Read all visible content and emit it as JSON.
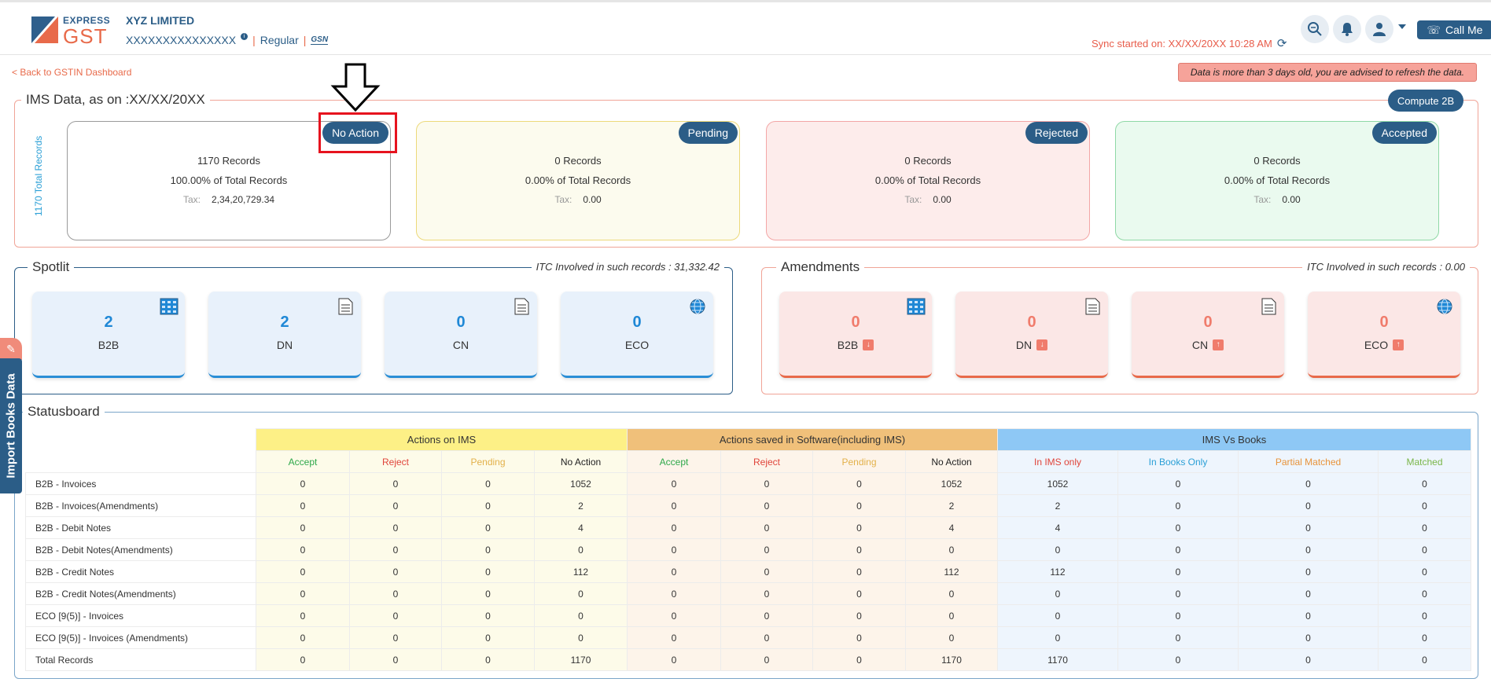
{
  "header": {
    "brand_top": "EXPRESS",
    "brand_main": "GST",
    "company": "XYZ LIMITED",
    "gstin": "XXXXXXXXXXXXXXX",
    "separator": "|",
    "reg_type": "Regular",
    "gsn_label": "GSN",
    "sync": "Sync started on: XX/XX/20XX 10:28 AM",
    "call_me": "Call Me",
    "icons": [
      "search-icon",
      "bell-icon",
      "user-icon",
      "phone-icon",
      "refresh-icon",
      "info-icon"
    ]
  },
  "nav": {
    "back": "< Back to GSTIN Dashboard",
    "warning": "Data is more than 3 days old, you are advised to refresh the data."
  },
  "ims": {
    "title": "IMS Data, as on :XX/XX/20XX",
    "compute": "Compute 2B",
    "total_vertical": "1170 Total Records",
    "tax_label": "Tax:",
    "cards": [
      {
        "badge": "No Action",
        "records": "1170 Records",
        "percent": "100.00% of Total Records",
        "tax": "2,34,20,729.34",
        "color": "#ffffff"
      },
      {
        "badge": "Pending",
        "records": "0 Records",
        "percent": "0.00% of Total Records",
        "tax": "0.00",
        "color": "#fcfbee"
      },
      {
        "badge": "Rejected",
        "records": "0 Records",
        "percent": "0.00% of Total Records",
        "tax": "0.00",
        "color": "#fdeceb"
      },
      {
        "badge": "Accepted",
        "records": "0 Records",
        "percent": "0.00% of Total Records",
        "tax": "0.00",
        "color": "#eafaef"
      }
    ]
  },
  "spotlit": {
    "title": "Spotlit",
    "itc": "ITC Involved in such records : 31,332.42",
    "tiles": [
      {
        "value": "2",
        "label": "B2B",
        "icon": "grid-table-icon"
      },
      {
        "value": "2",
        "label": "DN",
        "icon": "document-icon"
      },
      {
        "value": "0",
        "label": "CN",
        "icon": "document-icon"
      },
      {
        "value": "0",
        "label": "ECO",
        "icon": "globe-icon"
      }
    ]
  },
  "amendments": {
    "title": "Amendments",
    "itc": "ITC Involved in such records : 0.00",
    "tiles": [
      {
        "value": "0",
        "label": "B2B",
        "icon": "grid-table-icon",
        "arrow": "down"
      },
      {
        "value": "0",
        "label": "DN",
        "icon": "document-icon",
        "arrow": "down"
      },
      {
        "value": "0",
        "label": "CN",
        "icon": "document-icon",
        "arrow": "up"
      },
      {
        "value": "0",
        "label": "ECO",
        "icon": "globe-icon",
        "arrow": "up"
      }
    ]
  },
  "statusboard": {
    "title": "Statusboard",
    "groups": [
      "Actions on IMS",
      "Actions saved in Software(including IMS)",
      "IMS Vs Books"
    ],
    "sub_headers": [
      "Accept",
      "Reject",
      "Pending",
      "No Action",
      "Accept",
      "Reject",
      "Pending",
      "No Action",
      "In IMS only",
      "In Books Only",
      "Partial Matched",
      "Matched"
    ],
    "rows": [
      {
        "label": "B2B - Invoices",
        "values": [
          "0",
          "0",
          "0",
          "1052",
          "0",
          "0",
          "0",
          "1052",
          "1052",
          "0",
          "0",
          "0"
        ]
      },
      {
        "label": "B2B - Invoices(Amendments)",
        "values": [
          "0",
          "0",
          "0",
          "2",
          "0",
          "0",
          "0",
          "2",
          "2",
          "0",
          "0",
          "0"
        ]
      },
      {
        "label": "B2B - Debit Notes",
        "values": [
          "0",
          "0",
          "0",
          "4",
          "0",
          "0",
          "0",
          "4",
          "4",
          "0",
          "0",
          "0"
        ]
      },
      {
        "label": "B2B - Debit Notes(Amendments)",
        "values": [
          "0",
          "0",
          "0",
          "0",
          "0",
          "0",
          "0",
          "0",
          "0",
          "0",
          "0",
          "0"
        ]
      },
      {
        "label": "B2B - Credit Notes",
        "values": [
          "0",
          "0",
          "0",
          "112",
          "0",
          "0",
          "0",
          "112",
          "112",
          "0",
          "0",
          "0"
        ]
      },
      {
        "label": "B2B - Credit Notes(Amendments)",
        "values": [
          "0",
          "0",
          "0",
          "0",
          "0",
          "0",
          "0",
          "0",
          "0",
          "0",
          "0",
          "0"
        ]
      },
      {
        "label": "ECO [9(5)] - Invoices",
        "values": [
          "0",
          "0",
          "0",
          "0",
          "0",
          "0",
          "0",
          "0",
          "0",
          "0",
          "0",
          "0"
        ]
      },
      {
        "label": "ECO [9(5)] - Invoices (Amendments)",
        "values": [
          "0",
          "0",
          "0",
          "0",
          "0",
          "0",
          "0",
          "0",
          "0",
          "0",
          "0",
          "0"
        ]
      },
      {
        "label": "Total Records",
        "values": [
          "0",
          "0",
          "0",
          "1170",
          "0",
          "0",
          "0",
          "1170",
          "1170",
          "0",
          "0",
          "0"
        ]
      }
    ]
  },
  "side": {
    "import_books": "Import Books Data"
  }
}
